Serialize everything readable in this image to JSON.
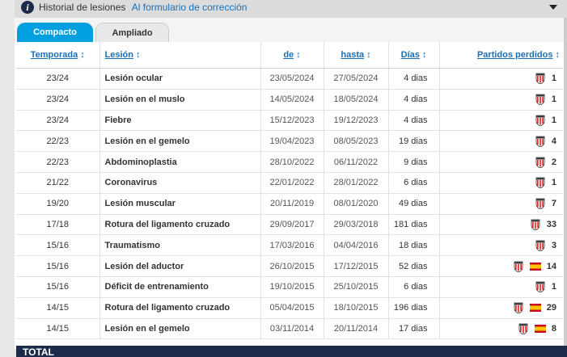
{
  "header": {
    "title": "Historial de lesiones",
    "link": "Al formulario de corrección"
  },
  "tabs": {
    "compact": "Compacto",
    "extended": "Ampliado"
  },
  "columns": {
    "season": "Temporada",
    "injury": "Lesión",
    "from": "de",
    "until": "hasta",
    "days": "Días",
    "games": "Partidos perdidos"
  },
  "sort_glyph": "↕",
  "rows": [
    {
      "season": "23/24",
      "injury": "Lesión ocular",
      "from": "23/05/2024",
      "until": "27/05/2024",
      "days": "4 dias",
      "flag": false,
      "games": "1"
    },
    {
      "season": "23/24",
      "injury": "Lesión en el muslo",
      "from": "14/05/2024",
      "until": "18/05/2024",
      "days": "4 dias",
      "flag": false,
      "games": "1"
    },
    {
      "season": "23/24",
      "injury": "Fiebre",
      "from": "15/12/2023",
      "until": "19/12/2023",
      "days": "4 dias",
      "flag": false,
      "games": "1"
    },
    {
      "season": "22/23",
      "injury": "Lesión en el gemelo",
      "from": "19/04/2023",
      "until": "08/05/2023",
      "days": "19 dias",
      "flag": false,
      "games": "4"
    },
    {
      "season": "22/23",
      "injury": "Abdominoplastia",
      "from": "28/10/2022",
      "until": "06/11/2022",
      "days": "9 dias",
      "flag": false,
      "games": "2"
    },
    {
      "season": "21/22",
      "injury": "Coronavirus",
      "from": "22/01/2022",
      "until": "28/01/2022",
      "days": "6 dias",
      "flag": false,
      "games": "1"
    },
    {
      "season": "19/20",
      "injury": "Lesión muscular",
      "from": "20/11/2019",
      "until": "08/01/2020",
      "days": "49 dias",
      "flag": false,
      "games": "7"
    },
    {
      "season": "17/18",
      "injury": "Rotura del ligamento cruzado",
      "from": "29/09/2017",
      "until": "29/03/2018",
      "days": "181 dias",
      "flag": false,
      "games": "33"
    },
    {
      "season": "15/16",
      "injury": "Traumatismo",
      "from": "17/03/2016",
      "until": "04/04/2016",
      "days": "18 dias",
      "flag": false,
      "games": "3"
    },
    {
      "season": "15/16",
      "injury": "Lesión del aductor",
      "from": "26/10/2015",
      "until": "17/12/2015",
      "days": "52 dias",
      "flag": true,
      "games": "14"
    },
    {
      "season": "15/16",
      "injury": "Déficit de entrenamiento",
      "from": "19/10/2015",
      "until": "25/10/2015",
      "days": "6 dias",
      "flag": false,
      "games": "1"
    },
    {
      "season": "14/15",
      "injury": "Rotura del ligamento cruzado",
      "from": "05/04/2015",
      "until": "18/10/2015",
      "days": "196 dias",
      "flag": true,
      "games": "29"
    },
    {
      "season": "14/15",
      "injury": "Lesión en el gemelo",
      "from": "03/11/2014",
      "until": "20/11/2014",
      "days": "17 dias",
      "flag": true,
      "games": "8"
    }
  ],
  "total_label": "TOTAL"
}
